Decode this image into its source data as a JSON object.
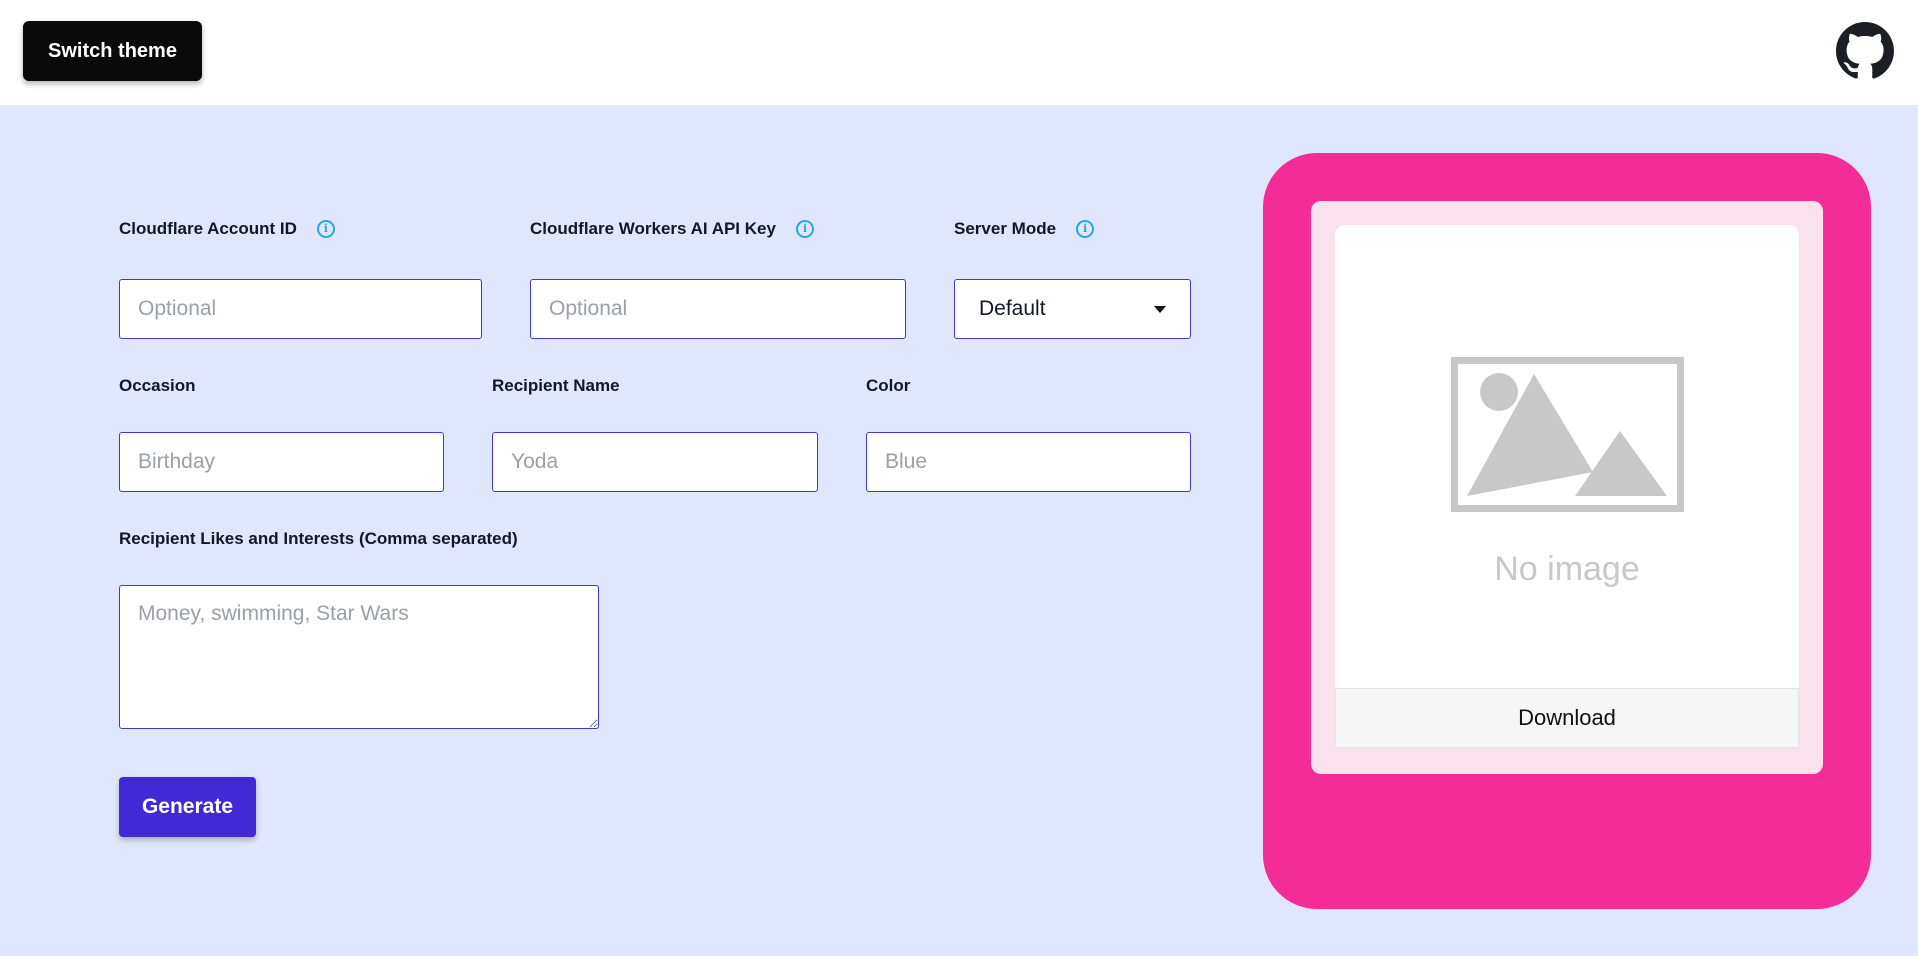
{
  "header": {
    "theme_button": "Switch theme",
    "github_icon": "github-icon"
  },
  "form": {
    "account_id": {
      "label": "Cloudflare Account ID",
      "placeholder": "Optional",
      "icon": "info-icon"
    },
    "api_key": {
      "label": "Cloudflare Workers AI API Key",
      "placeholder": "Optional",
      "icon": "info-icon"
    },
    "server_mode": {
      "label": "Server Mode",
      "value": "Default",
      "icon": "info-icon"
    },
    "occasion": {
      "label": "Occasion",
      "placeholder": "Birthday"
    },
    "recipient_name": {
      "label": "Recipient Name",
      "placeholder": "Yoda"
    },
    "color": {
      "label": "Color",
      "placeholder": "Blue"
    },
    "likes": {
      "label": "Recipient Likes and Interests (Comma separated)",
      "placeholder": "Money, swimming, Star Wars"
    },
    "generate_button": "Generate"
  },
  "preview": {
    "no_image_text": "No image",
    "download_button": "Download",
    "frame_color": "#f42c98",
    "card_color": "#f9e1ee"
  },
  "colors": {
    "background": "#e0e6fc",
    "accent": "#4328d6",
    "border": "#4338ca",
    "info": "#27a8e0"
  }
}
